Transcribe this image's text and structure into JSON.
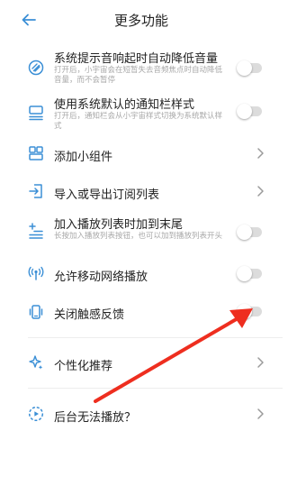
{
  "header": {
    "title": "更多功能",
    "back_icon": "arrow-left-icon"
  },
  "colors": {
    "accent": "#3b8fd6",
    "arrow": "#ee2e1f",
    "toggle_off": "#dcdcdc"
  },
  "items": [
    {
      "icon": "volume-limit-icon",
      "title": "系统提示音响起时自动降低音量",
      "desc": "打开后，小宇宙会在短暂失去音频焦点时自动降低音量，而不会暂停",
      "control": "toggle",
      "on": false
    },
    {
      "icon": "notification-style-icon",
      "title": "使用系统默认的通知栏样式",
      "desc": "打开后，通知栏会从小宇宙样式切换为系统默认样式",
      "control": "toggle",
      "on": false
    },
    {
      "icon": "widget-icon",
      "title": "添加小组件",
      "control": "chevron"
    },
    {
      "icon": "import-export-icon",
      "title": "导入或导出订阅列表",
      "control": "chevron"
    },
    {
      "icon": "playlist-add-icon",
      "title": "加入播放列表时加到末尾",
      "desc": "长按加入播放列表按钮，也可以加到播放列表开头",
      "control": "toggle",
      "on": false
    },
    {
      "icon": "mobile-network-icon",
      "title": "允许移动网络播放",
      "control": "toggle",
      "on": false
    },
    {
      "icon": "vibration-icon",
      "title": "关闭触感反馈",
      "control": "toggle",
      "on": false
    },
    {
      "icon": "sparkle-icon",
      "title": "个性化推荐",
      "control": "chevron"
    },
    {
      "icon": "background-play-icon",
      "title": "后台无法播放？",
      "control": "chevron"
    }
  ]
}
